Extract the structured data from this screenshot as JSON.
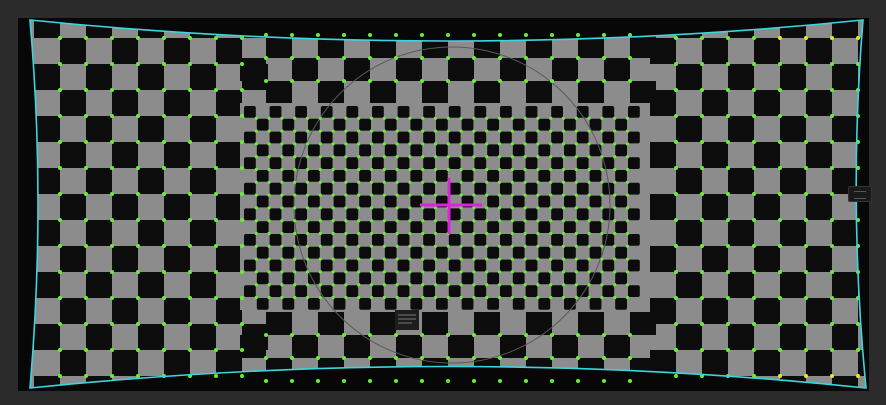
{
  "view": {
    "background": "#2b2b2b",
    "frame_background": "#070707",
    "target_light": "#8c8c8c",
    "target_dark": "#0c0c0c",
    "boundary_color": "#3ad6df",
    "corner_color": "#66ee33",
    "edge_corner_color": "#e6e61e",
    "crosshair_color": "#e020e0",
    "circle_color": "#5a5a5a"
  },
  "overlays": {
    "boundary": "distortion-boundary",
    "crosshair": "principal-point-marker",
    "circle": "reference-circle",
    "corners": "detected-corners"
  },
  "icons": {
    "side_handle": "panel-resize-handle"
  }
}
